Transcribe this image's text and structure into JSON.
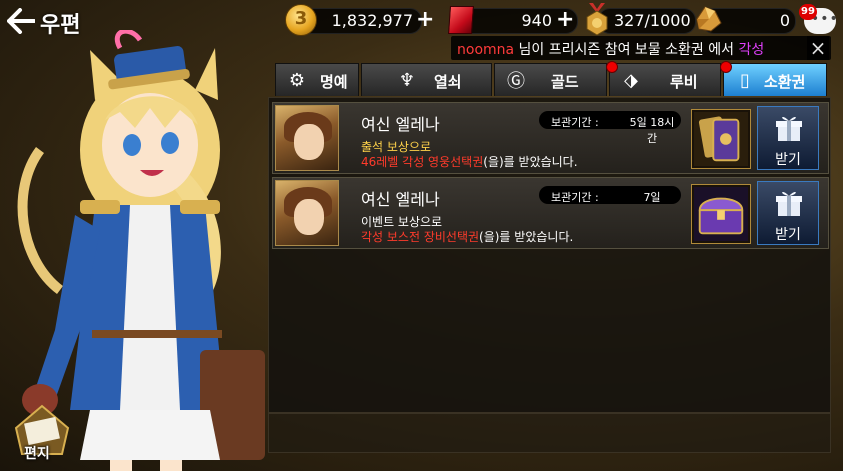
{
  "header": {
    "back_icon": "back-arrow-icon",
    "title": "우편"
  },
  "currency": {
    "gold": {
      "icon": "gold-coin-icon",
      "value": "1,832,977"
    },
    "ruby": {
      "icon": "ruby-gem-icon",
      "value": "940"
    },
    "stamina": {
      "icon": "medal-icon",
      "value": "327/1000"
    },
    "ore": {
      "icon": "ore-crystal-icon",
      "value": "0"
    },
    "coin_glyph": "3",
    "plus_glyph": "+"
  },
  "chat": {
    "icon": "chat-bubble-icon",
    "badge": "99",
    "dots": "•••"
  },
  "notice": {
    "user": "noomna",
    "text": " 님이  프리시즌  참여  보물  소환권  에서  ",
    "tail": "각성",
    "close": "×"
  },
  "tabs": [
    {
      "label": "명예",
      "icon": "honor-icon",
      "glyph": "⚙",
      "active": false,
      "new": false
    },
    {
      "label": "열쇠",
      "icon": "key-icon",
      "glyph": "♆",
      "active": false,
      "new": false
    },
    {
      "label": "골드",
      "icon": "gold-icon",
      "glyph": "Ⓖ",
      "active": false,
      "new": false
    },
    {
      "label": "루비",
      "icon": "ruby-tab-icon",
      "glyph": "⬗",
      "active": false,
      "new": true
    },
    {
      "label": "소환권",
      "icon": "summon-ticket-icon",
      "glyph": "▯",
      "active": true,
      "new": true
    }
  ],
  "mails": [
    {
      "name": "여신 엘레나",
      "keep_label": "보관기간 :",
      "keep_value": "5일 18시간",
      "line1": "출석 보상으로",
      "reward": "46레벨 각성 영웅선택권",
      "reward_suffix": "(을)를 받았습니다.",
      "item_icon": "hero-card-icon",
      "claim_label": "받기",
      "claim_icon": "gift-icon"
    },
    {
      "name": "여신 엘레나",
      "keep_label": "보관기간 :",
      "keep_value": "7일",
      "line1": "이벤트 보상으로",
      "reward": "각성 보스전 장비선택권",
      "reward_suffix": "(을)를 받았습니다.",
      "item_icon": "treasure-chest-icon",
      "claim_label": "받기",
      "claim_icon": "gift-icon"
    }
  ],
  "letter": {
    "label": "편지",
    "icon": "letter-icon"
  },
  "colors": {
    "accent": "#1d7fd0",
    "reward_red": "#ff3b2b",
    "notice_user": "#ff3b3b",
    "notice_tail": "#e040fb"
  }
}
